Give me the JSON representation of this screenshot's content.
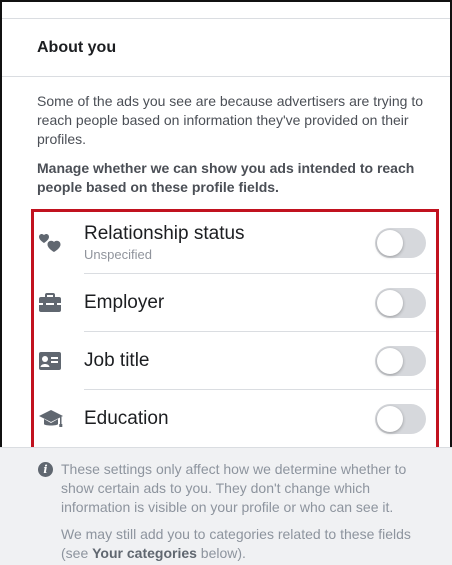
{
  "section": {
    "title": "About you"
  },
  "intro": {
    "paragraph1": "Some of the ads you see are because advertisers are trying to reach people based on information they've provided on their profiles.",
    "paragraph2": "Manage whether we can show you ads intended to reach people based on these profile fields."
  },
  "settings": [
    {
      "label": "Relationship status",
      "sublabel": "Unspecified",
      "icon": "hearts-icon",
      "enabled": false
    },
    {
      "label": "Employer",
      "icon": "briefcase-icon",
      "enabled": false
    },
    {
      "label": "Job title",
      "icon": "id-card-icon",
      "enabled": false
    },
    {
      "label": "Education",
      "icon": "graduation-cap-icon",
      "enabled": false
    }
  ],
  "footer": {
    "note": "These settings only affect how we determine whether to show certain ads to you. They don't change which information is visible on your profile or who can see it.",
    "extra_prefix": "We may still add you to categories related to these fields (see ",
    "extra_link": "Your categories",
    "extra_suffix": " below)."
  },
  "colors": {
    "highlight_border": "#c1121f",
    "toggle_off": "#d6d8dc",
    "icon": "#606770"
  }
}
